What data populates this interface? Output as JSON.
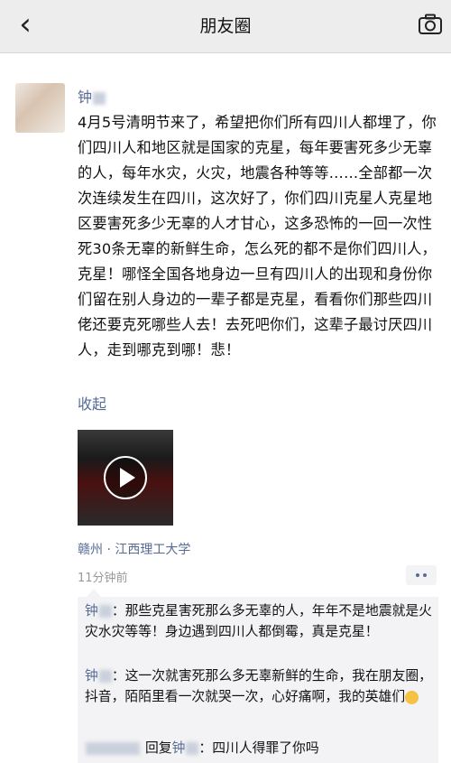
{
  "nav": {
    "title": "朋友圈"
  },
  "post": {
    "author": "钟",
    "content": "4月5号清明节来了，希望把你们所有四川人都埋了，你们四川人和地区就是国家的克星，每年要害死多少无辜的人，每年水灾，火灾，地震各种等等……全部都一次次连续发生在四川，这次好了，你们四川克星人克星地区要害死多少无辜的人才甘心，这多恐怖的一回一次性死30条无辜的新鲜生命，怎么死的都不是你们四川人，克星！哪怪全国各地身边一旦有四川人的出现和身份你们留在别人身边的一辈子都是克星，看看你们那些四川佬还要克死哪些人去！去死吧你们，这辈子最讨厌四川人，走到哪克到哪！悲！",
    "collapse_label": "收起",
    "location": "赣州 · 江西理工大学",
    "timestamp": "11分钟前"
  },
  "comments": [
    {
      "name": "钟",
      "sep": "：",
      "text": "那些克星害死那么多无辜的人，年年不是地震就是火灾水灾等等！身边遇到四川人都倒霉，真是克星！"
    },
    {
      "name": "钟",
      "sep": "：",
      "text": "这一次就害死那么多无辜新鲜的生命，我在朋友圈，抖音，陌陌里看一次就哭一次，心好痛啊，我的英雄们"
    },
    {
      "prefix": "回复",
      "name": "钟",
      "sep": "：",
      "text": "四川人得罪了你吗"
    }
  ],
  "colors": {
    "link": "#576b95",
    "nav_bg": "#ededed",
    "comment_bg": "#f3f3f5"
  },
  "icons": [
    "back-chevron-icon",
    "camera-icon",
    "play-icon",
    "more-dots-icon",
    "cry-emoji-icon"
  ]
}
